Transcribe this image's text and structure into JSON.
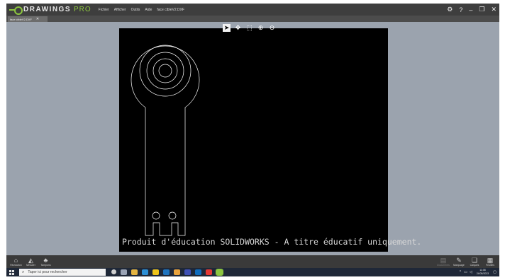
{
  "app": {
    "brand": "DRAWINGS",
    "edition": "PRO"
  },
  "menu": [
    "Fichier",
    "Afficher",
    "Outils",
    "Aide",
    "face cibleV2.DXF"
  ],
  "window_controls": {
    "settings": "⚙",
    "help": "?",
    "minimize": "–",
    "maximize": "❐",
    "close": "✕"
  },
  "document_tab": {
    "label": "face cibleV2.DXF",
    "close": "✕"
  },
  "viewer_tools": [
    "select-icon",
    "pan-icon",
    "zoom-window-icon",
    "zoom-in-icon",
    "zoom-out-icon"
  ],
  "watermark": "Produit d'éducation SOLIDWORKS - A titre éducatif uniquement.",
  "bottom_left": [
    {
      "icon": "home-icon",
      "label": "Révolution"
    },
    {
      "icon": "measure-icon",
      "label": "Mesurer"
    },
    {
      "icon": "stamp-icon",
      "label": "Tampons"
    }
  ],
  "bottom_right": [
    {
      "icon": "sheet-icon",
      "label": "Documents"
    },
    {
      "icon": "pencil-icon",
      "label": "Marquage"
    },
    {
      "icon": "layers-icon",
      "label": "Calques"
    },
    {
      "icon": "sheets-icon",
      "label": "Feuilles"
    }
  ],
  "taskbar": {
    "search_placeholder": "Taper ici pour rechercher",
    "time": "11:08",
    "date": "24/05/2023"
  },
  "colors": {
    "brand_green": "#8dc63f",
    "canvas": "#000000",
    "drawing_stroke": "#ffffff"
  }
}
